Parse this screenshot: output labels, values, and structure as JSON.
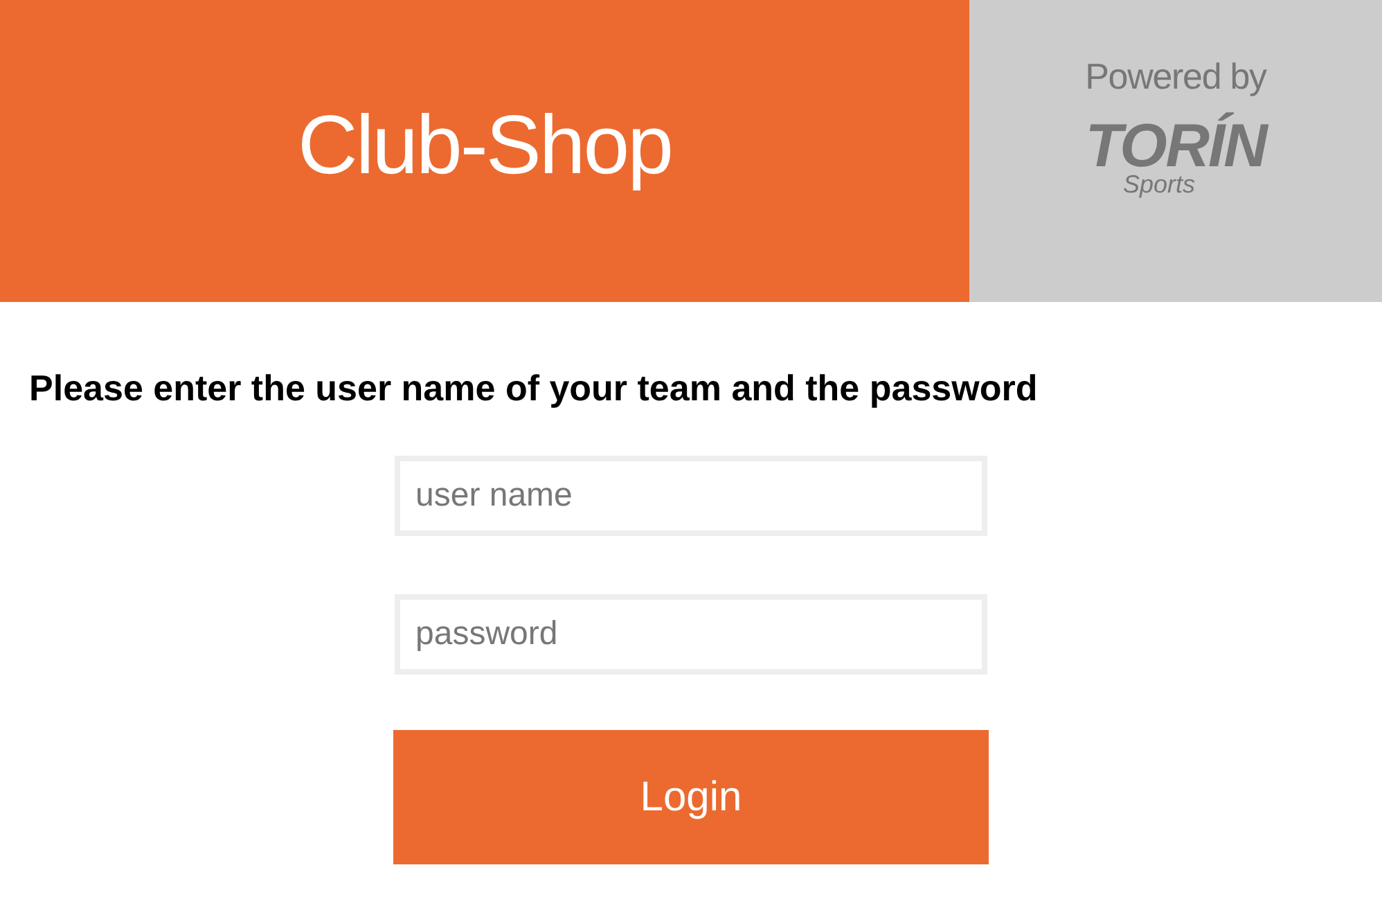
{
  "header": {
    "title": "Club-Shop",
    "powered_by": "Powered by",
    "logo": {
      "name": "TORÍN",
      "tagline": "Sports"
    }
  },
  "instruction": "Please enter the user name of your team and the password",
  "form": {
    "fields": [
      {
        "placeholder": "user name"
      },
      {
        "placeholder": "password"
      }
    ],
    "button": "Login"
  }
}
